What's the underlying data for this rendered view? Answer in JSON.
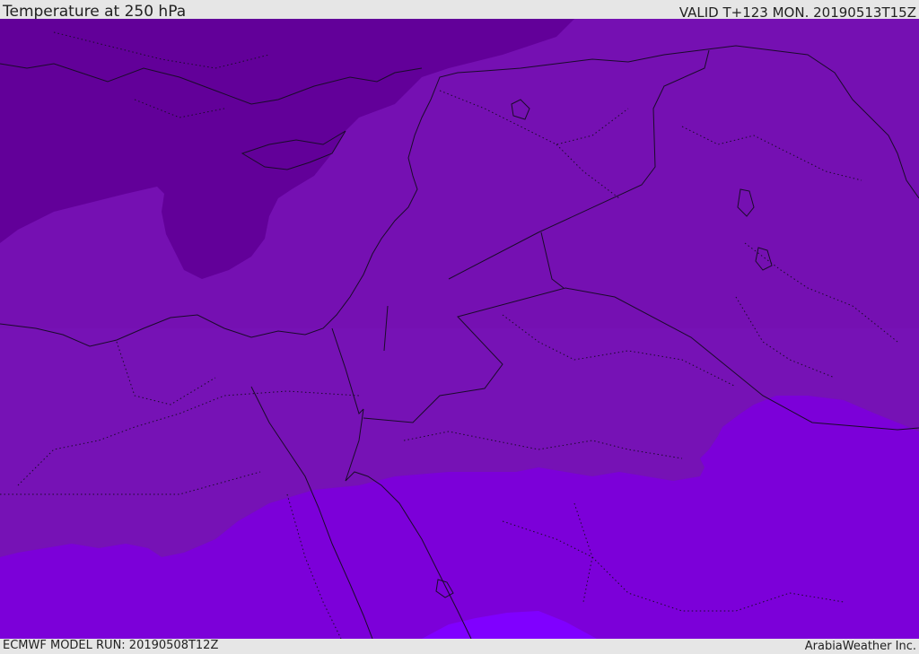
{
  "header": {
    "title": "Temperature at 250 hPa",
    "valid_time": "VALID T+123 MON. 20190513T15Z"
  },
  "footer": {
    "model_run": "ECMWF MODEL RUN: 20190508T12Z",
    "provider": "ArabiaWeather Inc."
  },
  "map": {
    "region": "Eastern Mediterranean / Middle East",
    "field": "temperature",
    "level": "250 hPa",
    "colors": {
      "coldest": "#620099",
      "cold": "#7510b2",
      "mid": "#7612b5",
      "warm": "#7c00d9",
      "warmest": "#8000ff",
      "coast_line": "#1a0b2a"
    }
  }
}
